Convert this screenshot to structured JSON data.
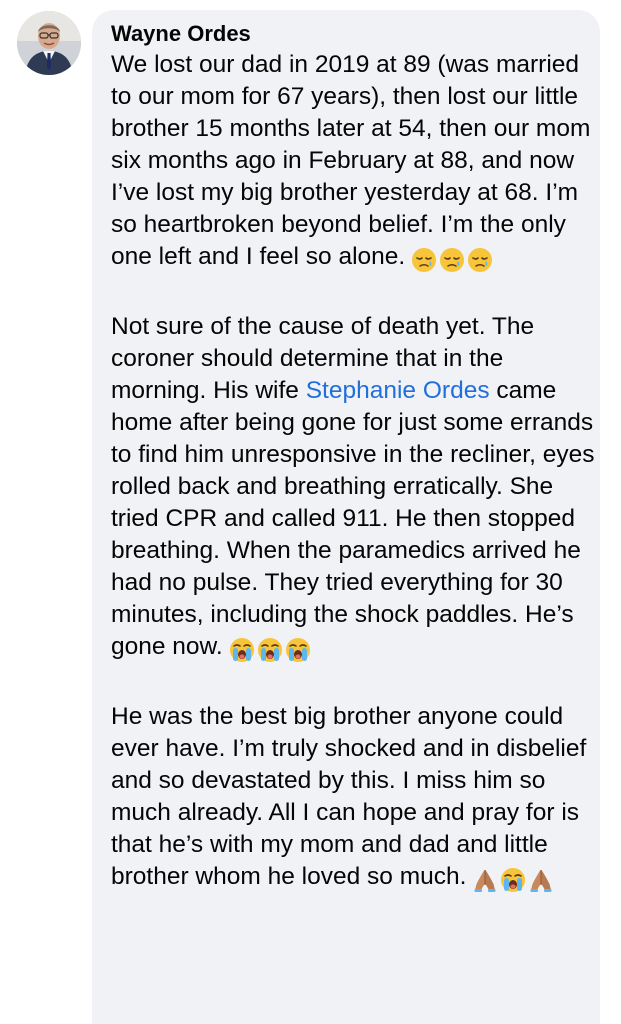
{
  "comment": {
    "author": "Wayne Ordes",
    "paragraphs": [
      {
        "text": "We lost our dad in 2019 at 89 (was married to our mom for 67 years), then lost our little brother 15 months later at 54, then our mom six months ago in February at 88, and now I’ve lost my big brother yesterday at 68. I’m so heartbroken beyond belief. I’m the only one left and I feel so alone.",
        "emojis": [
          "sleepy-tear-face-icon",
          "sleepy-tear-face-icon",
          "sleepy-tear-face-icon"
        ]
      },
      {
        "before_link": "Not sure of the cause of death yet. The coroner should determine that in the morning. His wife ",
        "link": "Stephanie Ordes",
        "after_link": " came home after being gone for just some errands to find him unresponsive in the recliner, eyes rolled back and breathing erratically. She tried CPR and called 911. He then stopped breathing. When the paramedics arrived he had no pulse. They tried everything for 30 minutes, including the shock paddles. He’s gone now.",
        "emojis": [
          "loudly-crying-face-icon",
          "loudly-crying-face-icon",
          "loudly-crying-face-icon"
        ]
      },
      {
        "text": "He was the best big brother anyone could ever have. I’m truly shocked and in disbelief and so devastated by this. I miss him so much already. All I can hope and pray for is that he’s with my mom and dad and little brother whom he loved so much.",
        "emojis": [
          "folded-hands-icon",
          "loudly-crying-face-icon",
          "folded-hands-icon"
        ]
      }
    ]
  },
  "colors": {
    "bubble_background": "#f0f2f5",
    "link": "#216fdb",
    "text": "#050505"
  }
}
